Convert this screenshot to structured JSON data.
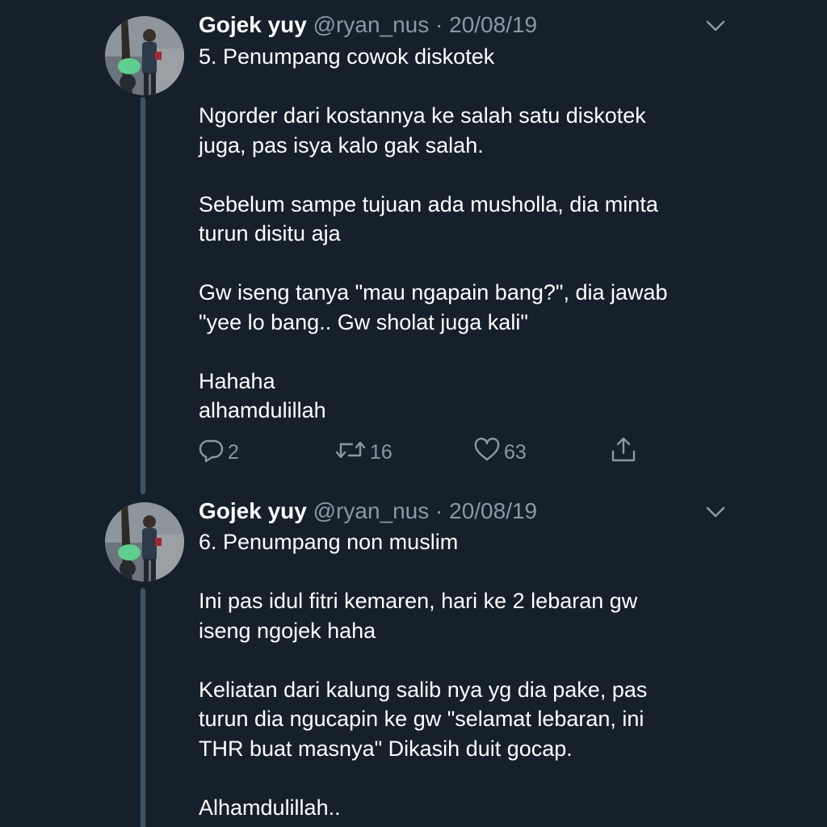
{
  "tweets": [
    {
      "author_name": "Gojek yuy",
      "handle": "@ryan_nus",
      "separator": "·",
      "date": "20/08/19",
      "lines": [
        "5. Penumpang cowok diskotek",
        "",
        "Ngorder dari kostannya ke salah satu diskotek",
        "juga, pas isya kalo gak salah.",
        "",
        "Sebelum sampe tujuan ada musholla, dia minta",
        "turun disitu aja",
        "",
        "Gw iseng tanya \"mau ngapain bang?\", dia jawab",
        "\"yee lo bang.. Gw sholat juga kali\"",
        "",
        "Hahaha",
        "alhamdulillah"
      ],
      "replies": "2",
      "retweets": "16",
      "likes": "63"
    },
    {
      "author_name": "Gojek yuy",
      "handle": "@ryan_nus",
      "separator": "·",
      "date": "20/08/19",
      "lines": [
        "6. Penumpang non muslim",
        "",
        "Ini pas idul fitri kemaren, hari ke 2 lebaran gw",
        "iseng ngojek haha",
        "",
        "Keliatan dari kalung salib nya yg dia pake, pas",
        "turun dia ngucapin ke gw \"selamat lebaran, ini",
        "THR buat masnya\" Dikasih duit gocap.",
        "",
        "Alhamdulillah.."
      ]
    }
  ],
  "icons": {
    "reply": "reply-icon",
    "retweet": "retweet-icon",
    "like": "heart-icon",
    "share": "share-icon",
    "more": "chevron-down-icon"
  },
  "colors": {
    "background": "#15202b",
    "secondary_text": "#8899a6",
    "thread_line": "#3d5466"
  }
}
